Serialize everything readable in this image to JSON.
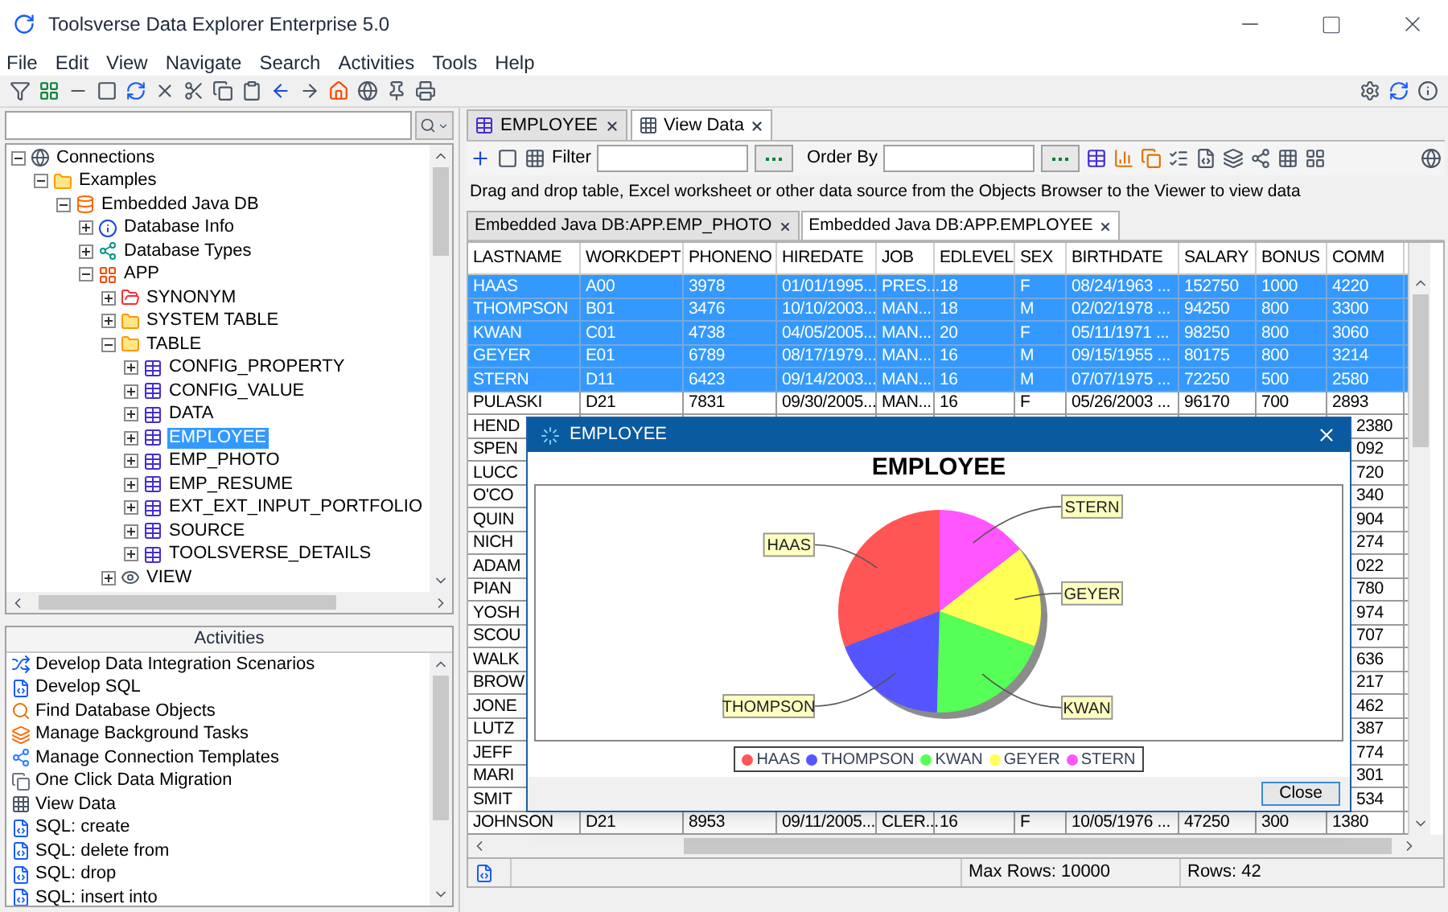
{
  "window": {
    "title": "Toolsverse Data Explorer Enterprise 5.0"
  },
  "menu": [
    "File",
    "Edit",
    "View",
    "Navigate",
    "Search",
    "Activities",
    "Tools",
    "Help"
  ],
  "left": {
    "tree": [
      {
        "label": "Connections",
        "kind": "globe",
        "expanded": true,
        "selected": false,
        "children": [
          {
            "label": "Examples",
            "kind": "folder",
            "expanded": true,
            "selected": false,
            "children": [
              {
                "label": "Embedded Java DB",
                "kind": "database",
                "expanded": true,
                "selected": false,
                "children": [
                  {
                    "label": "Database Info",
                    "kind": "info",
                    "expanded": false,
                    "selected": false
                  },
                  {
                    "label": "Database Types",
                    "kind": "types",
                    "expanded": false,
                    "selected": false
                  },
                  {
                    "label": "APP",
                    "kind": "schema",
                    "expanded": true,
                    "selected": false,
                    "children": [
                      {
                        "label": "SYNONYM",
                        "kind": "synonym",
                        "expanded": false,
                        "selected": false
                      },
                      {
                        "label": "SYSTEM TABLE",
                        "kind": "folder",
                        "expanded": false,
                        "selected": false
                      },
                      {
                        "label": "TABLE",
                        "kind": "folder",
                        "expanded": true,
                        "selected": false,
                        "children": [
                          {
                            "label": "CONFIG_PROPERTY",
                            "kind": "table",
                            "expanded": false,
                            "selected": false
                          },
                          {
                            "label": "CONFIG_VALUE",
                            "kind": "table",
                            "expanded": false,
                            "selected": false
                          },
                          {
                            "label": "DATA",
                            "kind": "table",
                            "expanded": false,
                            "selected": false
                          },
                          {
                            "label": "EMPLOYEE",
                            "kind": "table",
                            "expanded": false,
                            "selected": true
                          },
                          {
                            "label": "EMP_PHOTO",
                            "kind": "table",
                            "expanded": false,
                            "selected": false
                          },
                          {
                            "label": "EMP_RESUME",
                            "kind": "table",
                            "expanded": false,
                            "selected": false
                          },
                          {
                            "label": "EXT_EXT_INPUT_PORTFOLIO",
                            "kind": "table",
                            "expanded": false,
                            "selected": false
                          },
                          {
                            "label": "SOURCE",
                            "kind": "table",
                            "expanded": false,
                            "selected": false
                          },
                          {
                            "label": "TOOLSVERSE_DETAILS",
                            "kind": "table",
                            "expanded": false,
                            "selected": false
                          }
                        ]
                      },
                      {
                        "label": "VIEW",
                        "kind": "view",
                        "expanded": false,
                        "selected": false
                      }
                    ]
                  }
                ]
              }
            ]
          }
        ]
      }
    ],
    "activities_title": "Activities",
    "activities": [
      {
        "label": "Develop Data Integration Scenarios",
        "kind": "scenario"
      },
      {
        "label": "Develop SQL",
        "kind": "sql"
      },
      {
        "label": "Find Database Objects",
        "kind": "find"
      },
      {
        "label": "Manage Background Tasks",
        "kind": "tasks"
      },
      {
        "label": "Manage Connection Templates",
        "kind": "templates"
      },
      {
        "label": "One Click Data Migration",
        "kind": "migration"
      },
      {
        "label": "View Data",
        "kind": "grid"
      },
      {
        "label": "SQL: create",
        "kind": "sql"
      },
      {
        "label": "SQL: delete from",
        "kind": "sql"
      },
      {
        "label": "SQL: drop",
        "kind": "sql"
      },
      {
        "label": "SQL: insert into",
        "kind": "sql"
      }
    ]
  },
  "editor_tabs": [
    {
      "label": "EMPLOYEE",
      "kind": "table",
      "selected": false
    },
    {
      "label": "View Data",
      "kind": "grid",
      "selected": true
    }
  ],
  "view_toolbar": {
    "filter_label": "Filter",
    "order_label": "Order By"
  },
  "hint": "Drag and drop table, Excel worksheet or other data source from the Objects Browser to the Viewer to view data",
  "data_tabs": [
    {
      "label": "Embedded Java DB:APP.EMP_PHOTO",
      "selected": false
    },
    {
      "label": "Embedded Java DB:APP.EMPLOYEE",
      "selected": true
    }
  ],
  "table": {
    "columns": [
      "LASTNAME",
      "WORKDEPT",
      "PHONENO",
      "HIREDATE",
      "JOB",
      "EDLEVEL",
      "SEX",
      "BIRTHDATE",
      "SALARY",
      "BONUS",
      "COMM"
    ],
    "rows": [
      {
        "kind": "full",
        "selected": true,
        "cells": [
          "HAAS",
          "A00",
          "3978",
          "01/01/1995...",
          "PRES...",
          "18",
          "F",
          "08/24/1963 ...",
          "152750",
          "1000",
          "4220"
        ]
      },
      {
        "kind": "full",
        "selected": true,
        "cells": [
          "THOMPSON",
          "B01",
          "3476",
          "10/10/2003...",
          "MAN...",
          "18",
          "M",
          "02/02/1978 ...",
          "94250",
          "800",
          "3300"
        ]
      },
      {
        "kind": "full",
        "selected": true,
        "cells": [
          "KWAN",
          "C01",
          "4738",
          "04/05/2005...",
          "MAN...",
          "20",
          "F",
          "05/11/1971 ...",
          "98250",
          "800",
          "3060"
        ]
      },
      {
        "kind": "full",
        "selected": true,
        "cells": [
          "GEYER",
          "E01",
          "6789",
          "08/17/1979...",
          "MAN...",
          "16",
          "M",
          "09/15/1955 ...",
          "80175",
          "800",
          "3214"
        ]
      },
      {
        "kind": "full",
        "selected": true,
        "cells": [
          "STERN",
          "D11",
          "6423",
          "09/14/2003...",
          "MAN...",
          "16",
          "M",
          "07/07/1975 ...",
          "72250",
          "500",
          "2580"
        ]
      },
      {
        "kind": "full",
        "selected": false,
        "cells": [
          "PULASKI",
          "D21",
          "7831",
          "09/30/2005...",
          "MAN...",
          "16",
          "F",
          "05/26/2003 ...",
          "96170",
          "700",
          "2893"
        ]
      },
      {
        "kind": "covered",
        "selected": false,
        "cells": [
          "HEND",
          "2380"
        ]
      },
      {
        "kind": "covered",
        "selected": false,
        "cells": [
          "SPEN",
          "092"
        ]
      },
      {
        "kind": "covered",
        "selected": false,
        "cells": [
          "LUCC",
          "720"
        ]
      },
      {
        "kind": "covered",
        "selected": false,
        "cells": [
          "O'CO",
          "340"
        ]
      },
      {
        "kind": "covered",
        "selected": false,
        "cells": [
          "QUIN",
          "904"
        ]
      },
      {
        "kind": "covered",
        "selected": false,
        "cells": [
          "NICH",
          "274"
        ]
      },
      {
        "kind": "covered",
        "selected": false,
        "cells": [
          "ADAM",
          "022"
        ]
      },
      {
        "kind": "covered",
        "selected": false,
        "cells": [
          "PIAN",
          "780"
        ]
      },
      {
        "kind": "covered",
        "selected": false,
        "cells": [
          "YOSH",
          "974"
        ]
      },
      {
        "kind": "covered",
        "selected": false,
        "cells": [
          "SCOU",
          "707"
        ]
      },
      {
        "kind": "covered",
        "selected": false,
        "cells": [
          "WALK",
          "636"
        ]
      },
      {
        "kind": "covered",
        "selected": false,
        "cells": [
          "BROW",
          "217"
        ]
      },
      {
        "kind": "covered",
        "selected": false,
        "cells": [
          "JONE",
          "462"
        ]
      },
      {
        "kind": "covered",
        "selected": false,
        "cells": [
          "LUTZ",
          "387"
        ]
      },
      {
        "kind": "covered",
        "selected": false,
        "cells": [
          "JEFF",
          "774"
        ]
      },
      {
        "kind": "covered",
        "selected": false,
        "cells": [
          "MARI",
          "301"
        ]
      },
      {
        "kind": "covered",
        "selected": false,
        "cells": [
          "SMIT",
          "534"
        ]
      },
      {
        "kind": "full",
        "selected": false,
        "cells": [
          "JOHNSON",
          "D21",
          "8953",
          "09/11/2005...",
          "CLER...",
          "16",
          "F",
          "10/05/1976 ...",
          "47250",
          "300",
          "1380"
        ]
      }
    ]
  },
  "status": {
    "max_rows": "Max Rows: 10000",
    "rows": "Rows: 42"
  },
  "dialog": {
    "title": "EMPLOYEE",
    "chart_data": {
      "type": "pie",
      "title": "EMPLOYEE",
      "categories": [
        "HAAS",
        "THOMPSON",
        "KWAN",
        "GEYER",
        "STERN"
      ],
      "values": [
        30.7,
        18.9,
        19.8,
        16.1,
        14.5
      ]
    },
    "legend": [
      {
        "label": "HAAS",
        "color": "#ff5555"
      },
      {
        "label": "THOMPSON",
        "color": "#5555ff"
      },
      {
        "label": "KWAN",
        "color": "#55ff55"
      },
      {
        "label": "GEYER",
        "color": "#ffff55"
      },
      {
        "label": "STERN",
        "color": "#ff55ff"
      }
    ],
    "close_button": "Close"
  }
}
